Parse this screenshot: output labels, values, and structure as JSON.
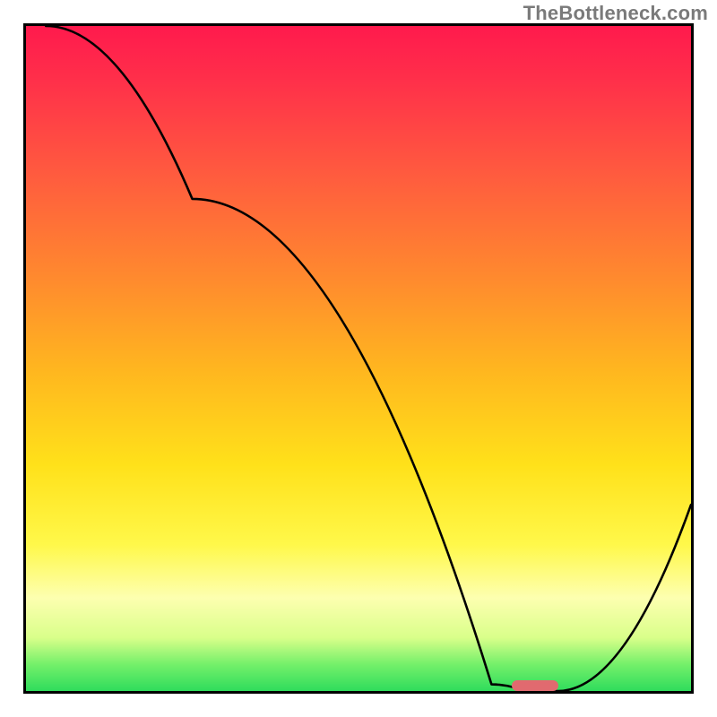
{
  "watermark": "TheBottleneck.com",
  "chart_data": {
    "type": "line",
    "title": "",
    "xlabel": "",
    "ylabel": "",
    "xlim": [
      0,
      100
    ],
    "ylim": [
      0,
      100
    ],
    "grid": false,
    "legend": false,
    "series": [
      {
        "name": "bottleneck-curve",
        "x": [
          3,
          25,
          70,
          75,
          80,
          100
        ],
        "y": [
          100,
          74,
          1,
          0,
          0,
          28
        ]
      }
    ],
    "background_gradient": {
      "0": "#ff1a4d",
      "8": "#ff2f4a",
      "22": "#ff5a3f",
      "38": "#ff8a2e",
      "52": "#ffb71f",
      "66": "#ffe11a",
      "78": "#fff84a",
      "86": "#fdffb0",
      "92": "#d9ff8a",
      "96": "#74f06a",
      "100": "#2fdc5c"
    },
    "marker": {
      "x_start": 73,
      "x_end": 80,
      "y": 0,
      "color": "#e16a6f"
    }
  }
}
